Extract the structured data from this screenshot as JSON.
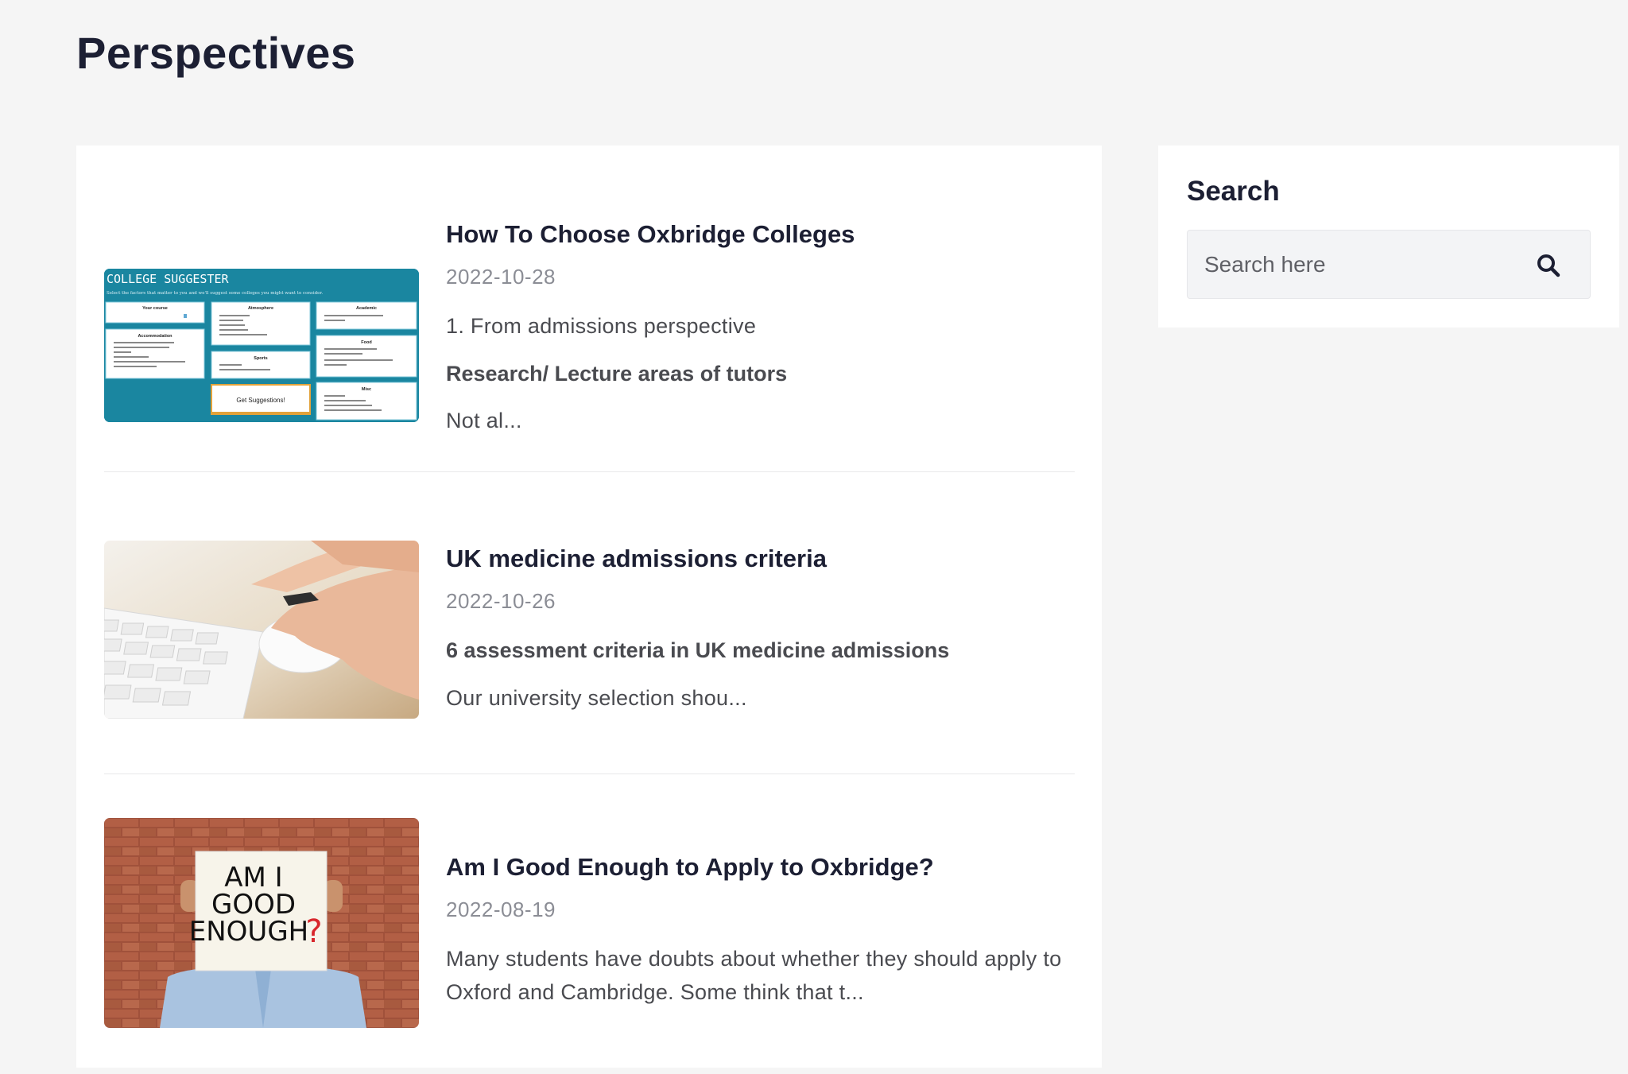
{
  "page": {
    "title": "Perspectives"
  },
  "posts": [
    {
      "title": "How To Choose Oxbridge Colleges",
      "date": "2022-10-28",
      "para1": "1. From admissions perspective",
      "strong": "Research/ Lecture areas of tutors",
      "excerpt": "Not al...",
      "thumb": {
        "heading": "COLLEGE SUGGESTER",
        "subheading": "Select the factors that matter to you and we'll suggest some colleges you might want to consider.",
        "your_course": "Your course",
        "atmosphere": "Atmosphere",
        "academic": "Academic",
        "accommodation": "Accommodation",
        "food": "Food",
        "sports": "Sports",
        "misc": "Misc",
        "button": "Get Suggestions!"
      }
    },
    {
      "title": "UK medicine admissions criteria",
      "date": "2022-10-26",
      "strong": "6 assessment criteria in UK medicine admissions",
      "excerpt": "Our university selection shou..."
    },
    {
      "title": "Am I Good Enough to Apply to Oxbridge?",
      "date": "2022-08-19",
      "excerpt": "Many students have doubts about whether they should apply to Oxford and Cambridge. Some think that t...",
      "sign": {
        "line1": "AM I",
        "line2": "GOOD",
        "line3": "ENOUGH",
        "mark": "?"
      }
    }
  ],
  "sidebar": {
    "title": "Search",
    "search_placeholder": "Search here"
  },
  "colors": {
    "heading": "#1c1f33",
    "muted": "#8b8d95",
    "body": "#4a4b50",
    "thumb_teal": "#1a86a0"
  }
}
